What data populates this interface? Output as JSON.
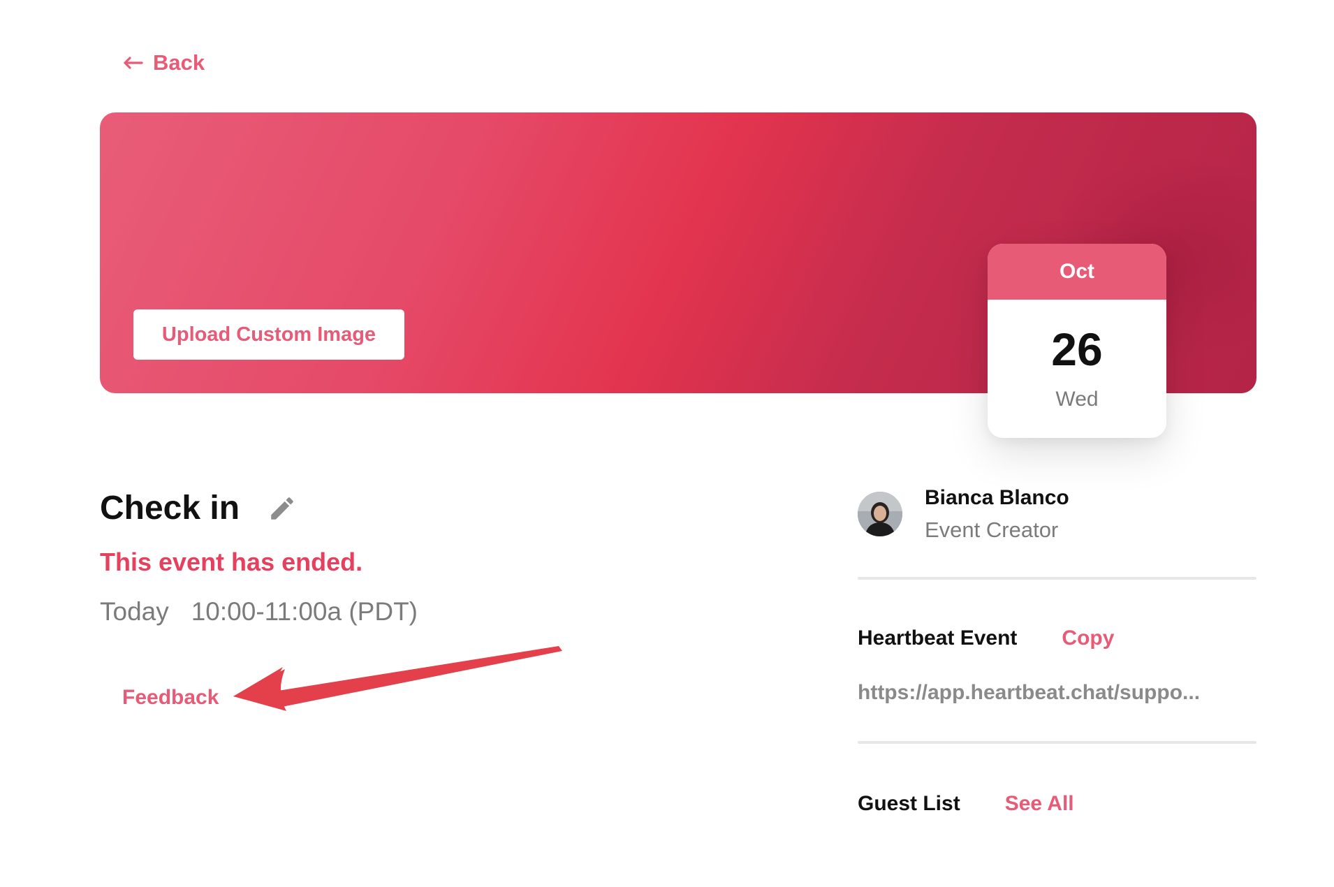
{
  "nav": {
    "back_label": "Back"
  },
  "banner": {
    "upload_label": "Upload Custom Image"
  },
  "date_card": {
    "month": "Oct",
    "day": "26",
    "weekday": "Wed"
  },
  "event": {
    "title": "Check in",
    "status": "This event has ended.",
    "day_label": "Today",
    "time_range": "10:00-11:00a (PDT)",
    "feedback_label": "Feedback"
  },
  "creator": {
    "name": "Bianca Blanco",
    "role": "Event Creator"
  },
  "heartbeat": {
    "label": "Heartbeat Event",
    "copy_label": "Copy",
    "url": "https://app.heartbeat.chat/suppo..."
  },
  "guest_list": {
    "label": "Guest List",
    "see_all_label": "See All"
  },
  "colors": {
    "accent": "#e75b77",
    "status_red": "#e5405e",
    "annotation_red": "#e3404b",
    "banner_start": "#e85d78",
    "banner_end": "#b32447"
  },
  "icons": [
    "arrow-left-icon",
    "pencil-icon",
    "annotation-arrow"
  ]
}
